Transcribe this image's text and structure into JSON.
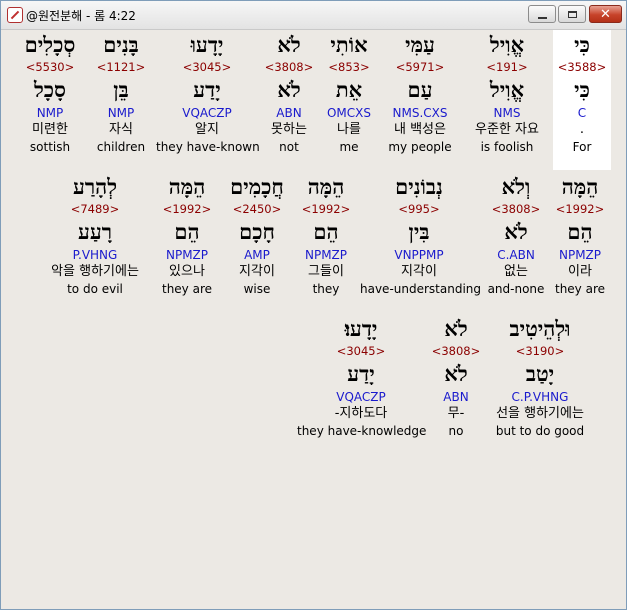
{
  "window": {
    "title": "@원전분해 - 롬 4:22",
    "controls": {
      "minimize": "minimize",
      "maximize": "maximize",
      "close": "✕"
    }
  },
  "rows": [
    {
      "words": [
        {
          "hebrew": "כִּי",
          "strong": "<3588>",
          "root": "כִּי",
          "morph": "C",
          "korean": ".",
          "english": "For",
          "selected": true
        },
        {
          "hebrew": "אֱוִיל",
          "strong": "<191>",
          "root": "אֱוִיל",
          "morph": "NMS",
          "korean": "우준한 자요",
          "english": "is foolish"
        },
        {
          "hebrew": "עַמִּי",
          "strong": "<5971>",
          "root": "עַם",
          "morph": "NMS.CXS",
          "korean": "내 백성은",
          "english": "my people"
        },
        {
          "hebrew": "אוֹתִי",
          "strong": "<853>",
          "root": "אֵת",
          "morph": "OMCXS",
          "korean": "나를",
          "english": "me"
        },
        {
          "hebrew": "לֹא",
          "strong": "<3808>",
          "root": "לֹא",
          "morph": "ABN",
          "korean": "못하는",
          "english": "not"
        },
        {
          "hebrew": "יָדָעוּ",
          "strong": "<3045>",
          "root": "יָדַע",
          "morph": "VQACZP",
          "korean": "알지",
          "english": "they have-known"
        },
        {
          "hebrew": "בָּנִים",
          "strong": "<1121>",
          "root": "בֵּן",
          "morph": "NMP",
          "korean": "자식",
          "english": "children"
        },
        {
          "hebrew": "סְכָלִים",
          "strong": "<5530>",
          "root": "סָכָל",
          "morph": "NMP",
          "korean": "미련한",
          "english": "sottish"
        }
      ]
    },
    {
      "words": [
        {
          "hebrew": "הֵמָּה",
          "strong": "<1992>",
          "root": "הֵם",
          "morph": "NPMZP",
          "korean": "이라",
          "english": "they are"
        },
        {
          "hebrew": "וְלֹא",
          "strong": "<3808>",
          "root": "לֹא",
          "morph": "C.ABN",
          "korean": "없는",
          "english": "and-none"
        },
        {
          "hebrew": "נְבוֹנִים",
          "strong": "<995>",
          "root": "בִּין",
          "morph": "VNPPMP",
          "korean": "지각이",
          "english": "have-understanding"
        },
        {
          "hebrew": "הֵמָּה",
          "strong": "<1992>",
          "root": "הֵם",
          "morph": "NPMZP",
          "korean": "그들이",
          "english": "they"
        },
        {
          "hebrew": "חֲכָמִים",
          "strong": "<2450>",
          "root": "חָכָם",
          "morph": "AMP",
          "korean": "지각이",
          "english": "wise"
        },
        {
          "hebrew": "הֵמָּה",
          "strong": "<1992>",
          "root": "הֵם",
          "morph": "NPMZP",
          "korean": "있으나",
          "english": "they are"
        },
        {
          "hebrew": "לְהָרַע",
          "strong": "<7489>",
          "root": "רָעַע",
          "morph": "P.VHNG",
          "korean": "악을 행하기에는",
          "english": "to do evil"
        }
      ]
    },
    {
      "words": [
        {
          "hebrew": "וּלְהֵיטִיב",
          "strong": "<3190>",
          "root": "יָטַב",
          "morph": "C.P.VHNG",
          "korean": "선을 행하기에는",
          "english": "but to do good"
        },
        {
          "hebrew": "לֹא",
          "strong": "<3808>",
          "root": "לֹא",
          "morph": "ABN",
          "korean": "무-",
          "english": "no"
        },
        {
          "hebrew": "יָדָעוּ׃",
          "strong": "<3045>",
          "root": "יָדַע",
          "morph": "VQACZP",
          "korean": "-지하도다",
          "english": "they have-knowledge"
        }
      ]
    }
  ]
}
